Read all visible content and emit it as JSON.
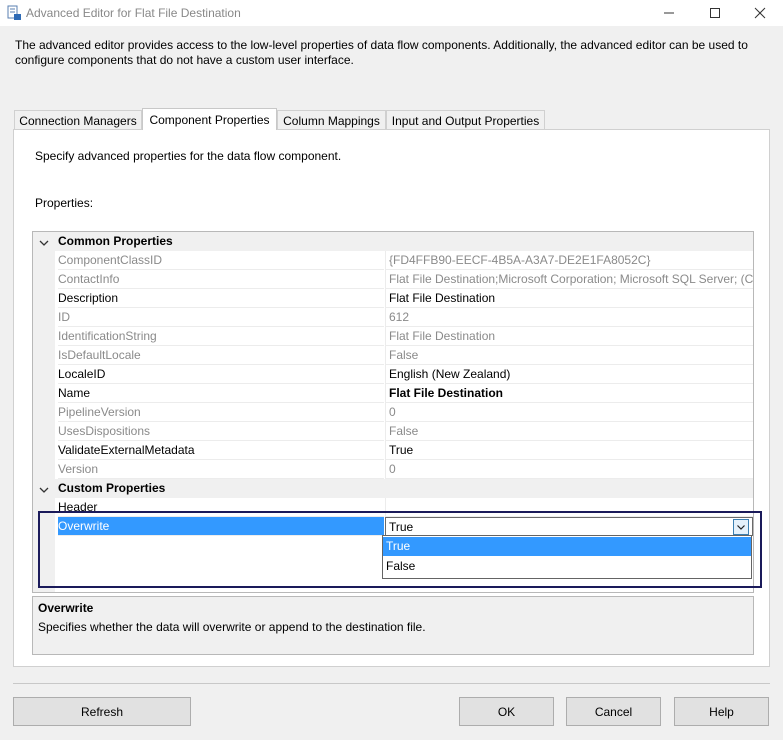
{
  "window": {
    "title": "Advanced Editor for Flat File Destination"
  },
  "intro": "The advanced editor provides access to the low-level properties of data flow components. Additionally, the advanced editor can be used to configure components that do not have a custom user interface.",
  "tabs": [
    {
      "label": "Connection Managers"
    },
    {
      "label": "Component Properties"
    },
    {
      "label": "Column Mappings"
    },
    {
      "label": "Input and Output Properties"
    }
  ],
  "panel": {
    "description": "Specify advanced properties for the data flow component.",
    "properties_label": "Properties:"
  },
  "grid": {
    "common_category": "Common Properties",
    "common": [
      {
        "name": "ComponentClassID",
        "value": "{FD4FFB90-EECF-4B5A-A3A7-DE2E1FA8052C}"
      },
      {
        "name": "ContactInfo",
        "value": "Flat File Destination;Microsoft Corporation; Microsoft SQL Server; (C)"
      },
      {
        "name": "Description",
        "value": "Flat File Destination"
      },
      {
        "name": "ID",
        "value": "612"
      },
      {
        "name": "IdentificationString",
        "value": "Flat File Destination"
      },
      {
        "name": "IsDefaultLocale",
        "value": "False"
      },
      {
        "name": "LocaleID",
        "value": "English (New Zealand)"
      },
      {
        "name": "Name",
        "value": "Flat File Destination"
      },
      {
        "name": "PipelineVersion",
        "value": "0"
      },
      {
        "name": "UsesDispositions",
        "value": "False"
      },
      {
        "name": "ValidateExternalMetadata",
        "value": "True"
      },
      {
        "name": "Version",
        "value": "0"
      }
    ],
    "custom_category": "Custom Properties",
    "custom": [
      {
        "name": "Header",
        "value": ""
      },
      {
        "name": "Overwrite",
        "value": "True"
      }
    ],
    "dropdown_options": [
      "True",
      "False"
    ]
  },
  "description_box": {
    "title": "Overwrite",
    "text": "Specifies whether the data will overwrite or append to the destination file."
  },
  "buttons": {
    "refresh": "Refresh",
    "ok": "OK",
    "cancel": "Cancel",
    "help": "Help"
  }
}
